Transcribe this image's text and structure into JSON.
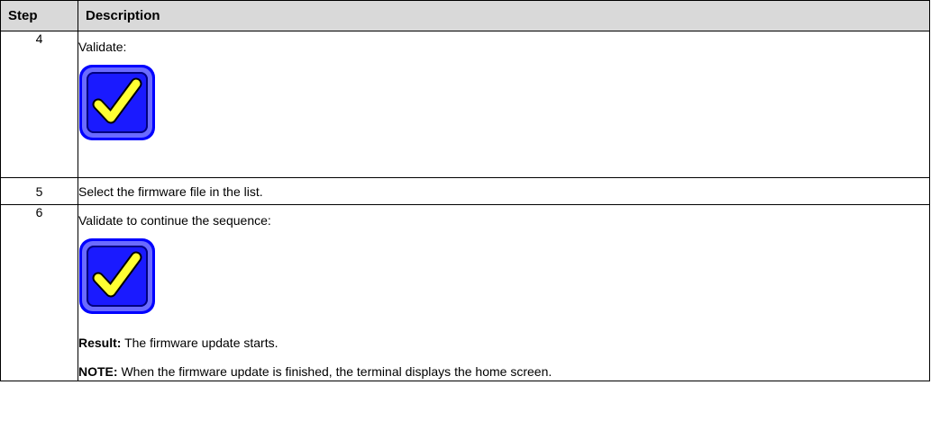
{
  "table": {
    "headers": {
      "step": "Step",
      "description": "Description"
    },
    "rows": [
      {
        "step": "4",
        "text": "Validate:",
        "icon": "validate-checkmark-icon"
      },
      {
        "step": "5",
        "text": "Select the firmware file in the list."
      },
      {
        "step": "6",
        "text": "Validate to continue the sequence:",
        "icon": "validate-checkmark-icon",
        "result_label": "Result:",
        "result_text": " The firmware update starts.",
        "note_label": "NOTE:",
        "note_text": " When the firmware update is finished, the terminal displays the home screen."
      }
    ]
  },
  "colors": {
    "header_bg": "#d9d9d9",
    "icon_border": "#0000ff",
    "icon_face": "#1a1aff",
    "icon_check": "#ffff33",
    "icon_shadow": "#000080"
  }
}
